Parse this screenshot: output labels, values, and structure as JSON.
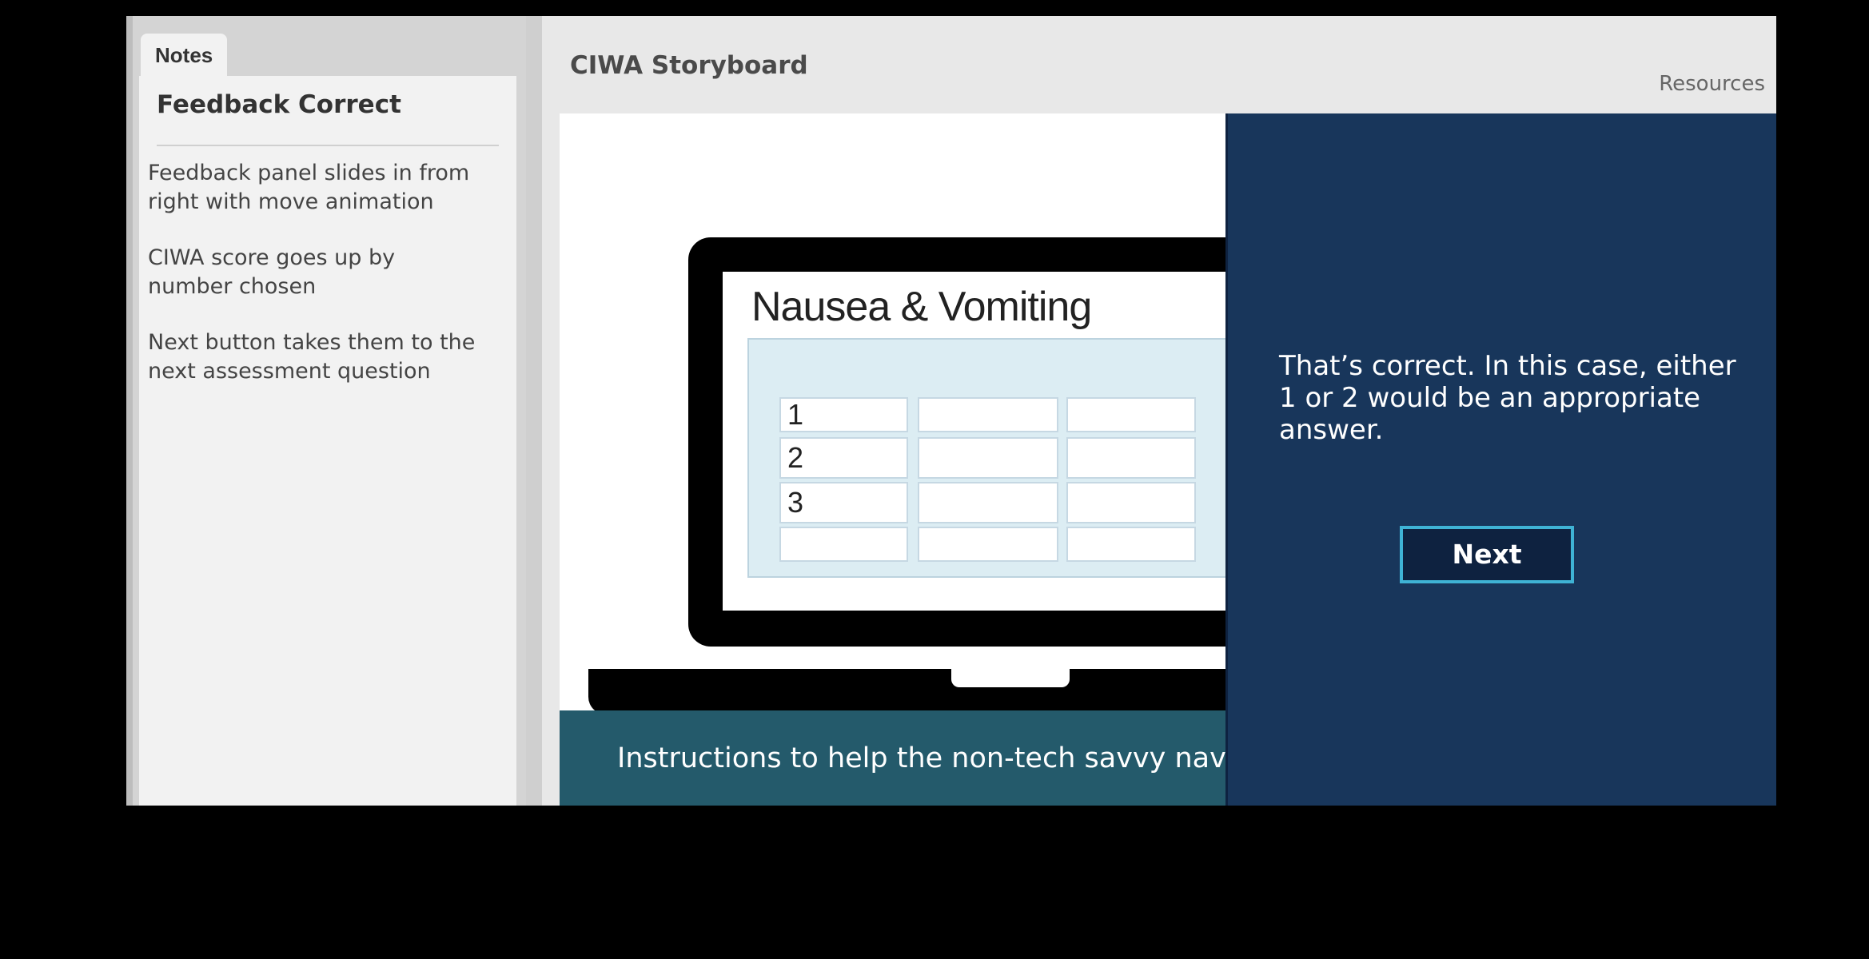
{
  "notes": {
    "tab_label": "Notes",
    "title": "Feedback Correct",
    "items": [
      "Feedback panel slides in from right with move animation",
      "CIWA score goes up by number chosen",
      "Next button takes them to the next assessment question"
    ]
  },
  "storyboard": {
    "title": "CIWA Storyboard",
    "resources_label": "Resources"
  },
  "slide": {
    "heading": "Nausea & Vomiting",
    "score_rows": [
      [
        "1",
        "",
        ""
      ],
      [
        "2",
        "",
        ""
      ],
      [
        "3",
        "",
        ""
      ],
      [
        "",
        "",
        ""
      ]
    ],
    "instruction": "Instructions to help the non-tech savvy navigate"
  },
  "feedback": {
    "message": "That’s correct. In this case, either 1 or 2 would be an appropriate answer.",
    "next_label": "Next"
  },
  "colors": {
    "feedback_bg": "#18365b",
    "button_border": "#3fb3d5",
    "instruction_bar": "#245a6b"
  }
}
